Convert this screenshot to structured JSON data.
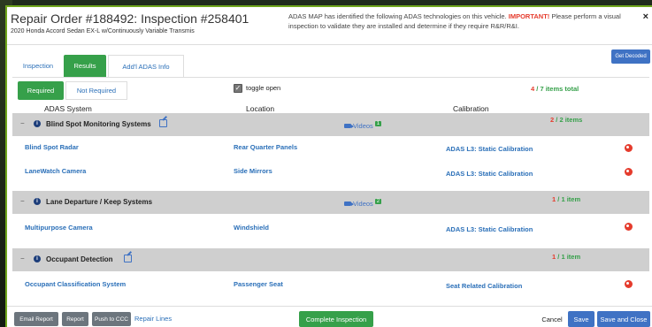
{
  "header": {
    "title": "Repair Order #188492: Inspection #258401",
    "subtitle": "2020 Honda Accord Sedan EX-L w/Continuously Variable Transmis",
    "message_pre": "ADAS MAP has identified the following ADAS technologies on this vehicle. ",
    "message_important": "IMPORTANT!",
    "message_post": " Please perform a visual inspection to validate they are installed and determine if they require R&R/R&I.",
    "close_label": "×"
  },
  "tabs": [
    {
      "label": "Inspection",
      "active": false
    },
    {
      "label": "Results",
      "active": true
    },
    {
      "label": "Add'l ADAS Info",
      "active": false
    }
  ],
  "get_decoded_label": "Get Decoded",
  "subtabs": [
    {
      "label": "Required",
      "active": true
    },
    {
      "label": "Not Required",
      "active": false
    }
  ],
  "toggle": {
    "label": "toggle open",
    "checked": true,
    "check_glyph": "✓"
  },
  "summary": {
    "count": "4",
    "total": "7",
    "suffix": "items total"
  },
  "columns": {
    "system": "ADAS System",
    "location": "Location",
    "calibration": "Calibration"
  },
  "groups": [
    {
      "name": "Blind Spot Monitoring Systems",
      "has_link_icon": true,
      "videos_label": "Videos",
      "videos_count": "1",
      "count": "2",
      "total": "2",
      "count_suffix": "items",
      "items": [
        {
          "system": "Blind Spot Radar",
          "location": "Rear Quarter Panels",
          "calibration": "ADAS L3: Static Calibration"
        },
        {
          "system": "LaneWatch Camera",
          "location": "Side Mirrors",
          "calibration": "ADAS L3: Static Calibration"
        }
      ]
    },
    {
      "name": "Lane Departure / Keep Systems",
      "has_link_icon": false,
      "videos_label": "Videos",
      "videos_count": "2",
      "count": "1",
      "total": "1",
      "count_suffix": "item",
      "items": [
        {
          "system": "Multipurpose Camera",
          "location": "Windshield",
          "calibration": "ADAS L3: Static Calibration"
        }
      ]
    },
    {
      "name": "Occupant Detection",
      "has_link_icon": true,
      "videos_label": "",
      "videos_count": "",
      "count": "1",
      "total": "1",
      "count_suffix": "item",
      "items": [
        {
          "system": "Occupant Classification System",
          "location": "Passenger Seat",
          "calibration": "Seat Related Calibration"
        }
      ]
    }
  ],
  "footer": {
    "email_report": "Email Report",
    "report": "Report",
    "push_to_ccc": "Push to CCC",
    "repair_lines": "Repair Lines",
    "complete_inspection": "Complete Inspection",
    "cancel": "Cancel",
    "save": "Save",
    "save_and_close": "Save and Close"
  },
  "colors": {
    "accent_green": "#36a04a",
    "link_blue": "#2a6fb8",
    "button_blue": "#3f72c4",
    "alert_red": "#e53b2c",
    "group_gray": "#cfcfcf"
  },
  "icons": [
    "close-icon",
    "checkbox-icon",
    "minus-icon",
    "info-icon",
    "external-link-icon",
    "video-camera-icon",
    "remove-icon"
  ]
}
